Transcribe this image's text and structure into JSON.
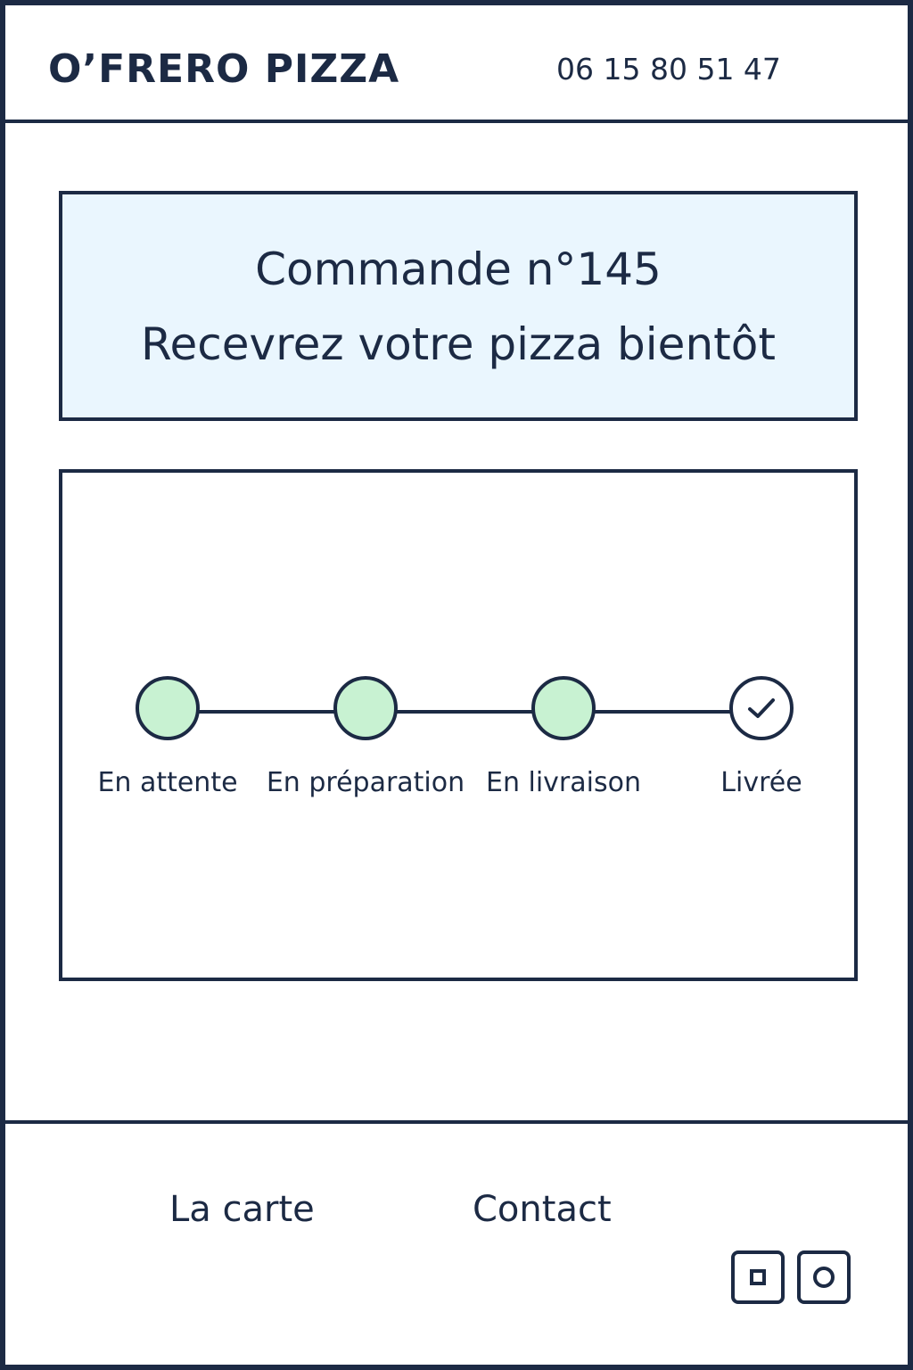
{
  "header": {
    "brand": "O’FRERO PIZZA",
    "phone": "06 15 80 51 47"
  },
  "order": {
    "number": "Commande n°145",
    "message": "Recevrez votre pizza bientôt"
  },
  "tracker": {
    "steps": [
      {
        "label": "En attente",
        "state": "done"
      },
      {
        "label": "En préparation",
        "state": "done"
      },
      {
        "label": "En livraison",
        "state": "done"
      },
      {
        "label": "Livrée",
        "state": "final"
      }
    ],
    "colors": {
      "done": "#c8f2d2",
      "line": "#1c2a44"
    }
  },
  "footer": {
    "nav": {
      "menu": "La carte",
      "contact": "Contact"
    },
    "icons": [
      "square-icon",
      "circle-icon"
    ]
  },
  "colors": {
    "primary": "#1c2a44",
    "order_box_bg": "#eaf6fe",
    "step_done": "#c8f2d2"
  }
}
